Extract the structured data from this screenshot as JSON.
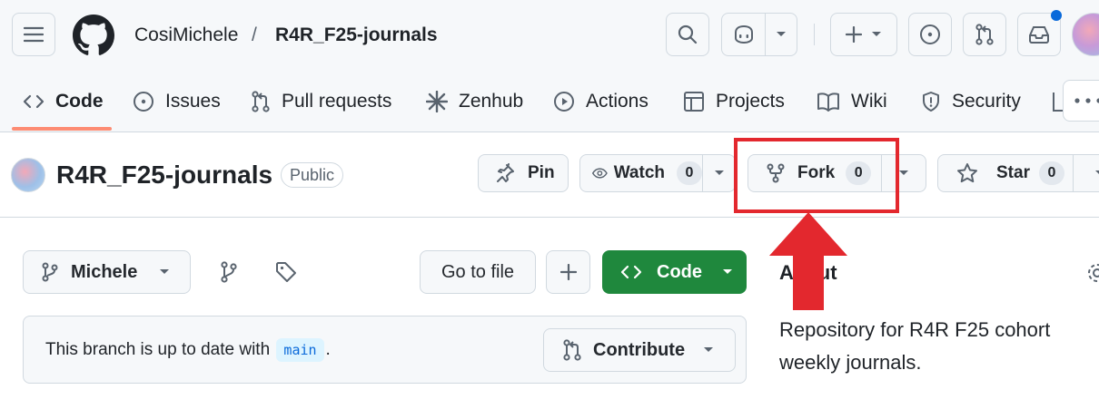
{
  "header": {
    "owner": "CosiMichele",
    "separator": "/",
    "repo": "R4R_F25-journals",
    "notification_dot_color": "#0969da"
  },
  "tabs": [
    {
      "label": "Code",
      "icon": "code-icon",
      "selected": true
    },
    {
      "label": "Issues",
      "icon": "issue-opened-icon"
    },
    {
      "label": "Pull requests",
      "icon": "git-pull-request-icon"
    },
    {
      "label": "Zenhub",
      "icon": "zenhub-icon"
    },
    {
      "label": "Actions",
      "icon": "play-icon"
    },
    {
      "label": "Projects",
      "icon": "table-icon"
    },
    {
      "label": "Wiki",
      "icon": "book-icon"
    },
    {
      "label": "Security",
      "icon": "shield-icon"
    }
  ],
  "repo_header": {
    "title": "R4R_F25-journals",
    "visibility": "Public",
    "pin_label": "Pin",
    "watch_label": "Watch",
    "watch_count": "0",
    "fork_label": "Fork",
    "fork_count": "0",
    "star_label": "Star",
    "star_count": "0"
  },
  "toolbar": {
    "branch": "Michele",
    "go_to_file": "Go to file",
    "code_label": "Code"
  },
  "notice": {
    "text_before": "This branch is up to date with",
    "branch_ref": "main",
    "text_after": ".",
    "contribute_label": "Contribute"
  },
  "about": {
    "title": "About",
    "description": "Repository for R4R F25 cohort weekly journals."
  },
  "colors": {
    "accent_green": "#1f883d",
    "annotation_red": "#e3282e",
    "tab_underline": "#fd8c73"
  }
}
